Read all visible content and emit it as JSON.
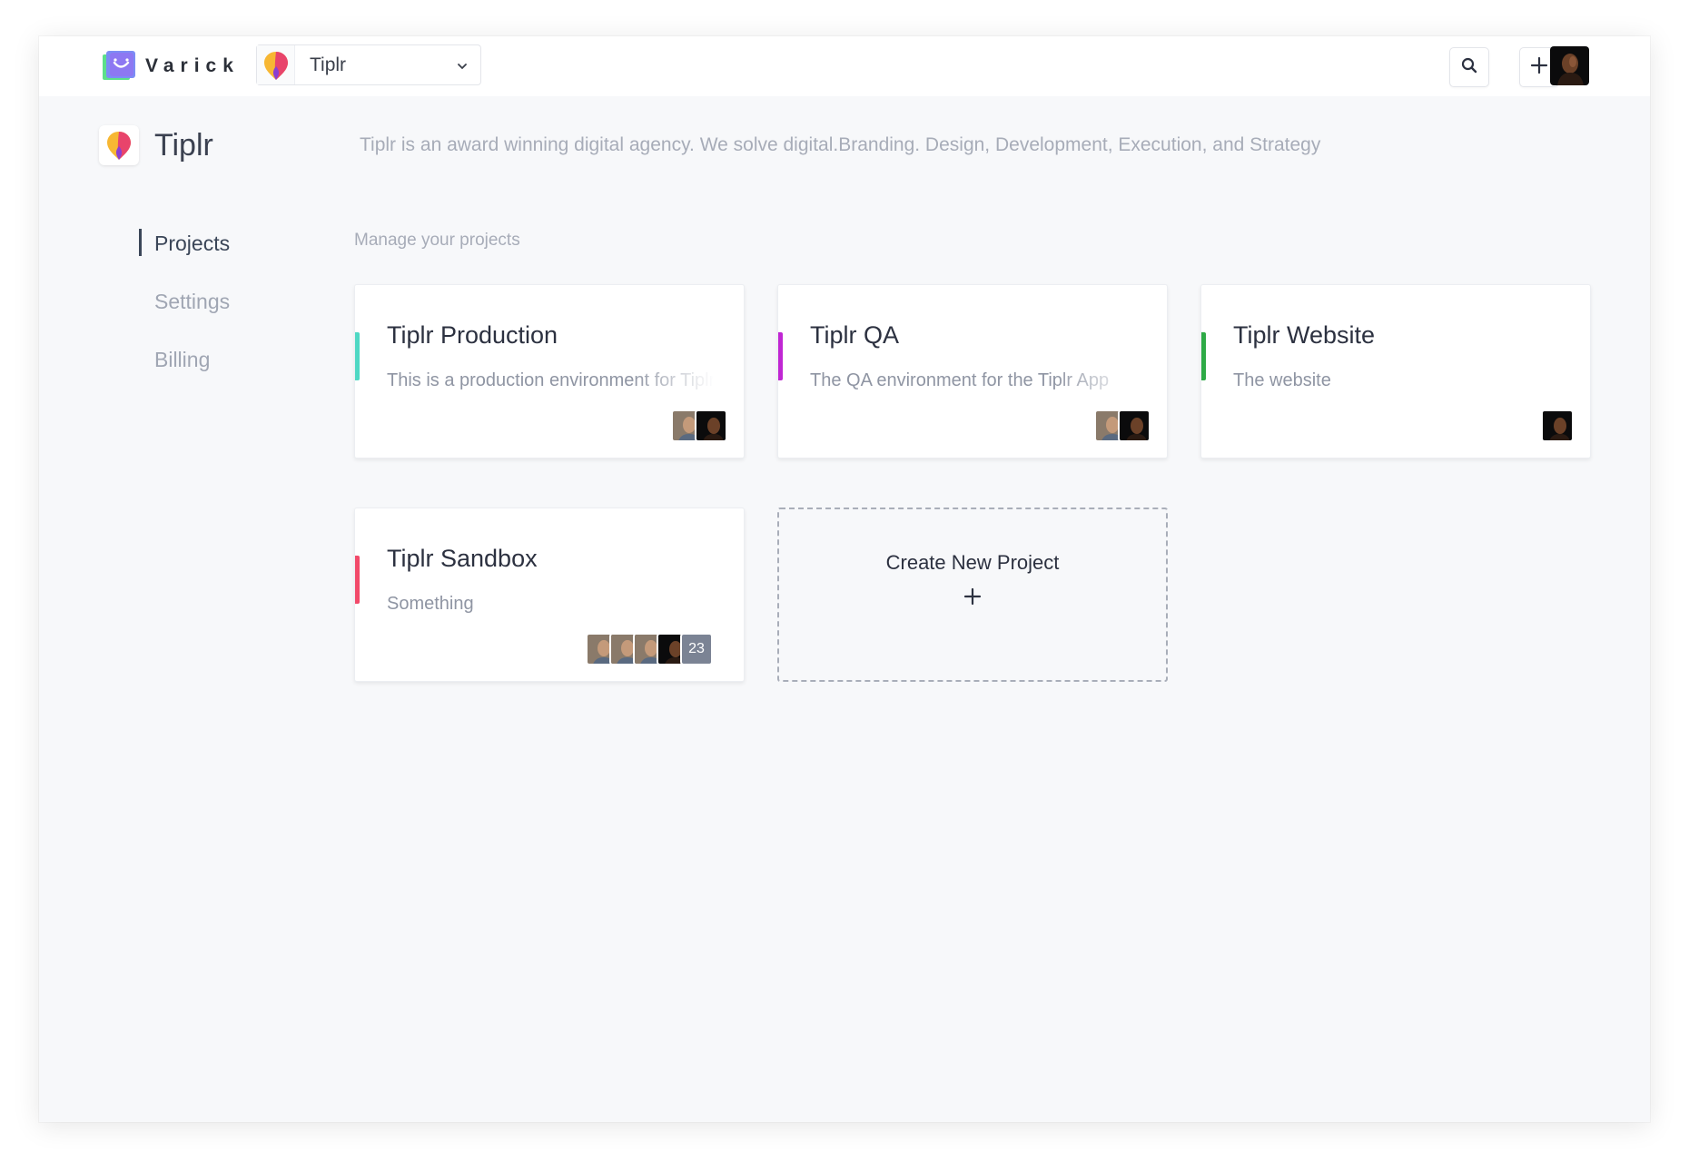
{
  "app": {
    "brand_name": "Varick"
  },
  "topbar": {
    "workspace_selected": "Tiplr",
    "search_icon": "search-icon",
    "add_icon": "plus-icon"
  },
  "organization": {
    "name": "Tiplr",
    "description": "Tiplr is an award winning digital agency. We solve digital.Branding. Design, Development, Execution, and Strategy"
  },
  "sidebar": {
    "items": [
      {
        "label": "Projects",
        "active": true
      },
      {
        "label": "Settings",
        "active": false
      },
      {
        "label": "Billing",
        "active": false
      }
    ]
  },
  "main": {
    "section_label": "Manage your projects",
    "projects": [
      {
        "title": "Tiplr Production",
        "description": "This is a production environment for Tiplr",
        "accent": "#4fd8c4"
      },
      {
        "title": "Tiplr QA",
        "description": "The QA environment for the Tiplr App",
        "accent": "#c026d3"
      },
      {
        "title": "Tiplr Website",
        "description": "The website",
        "accent": "#2eaa46"
      },
      {
        "title": "Tiplr Sandbox",
        "description": "Something",
        "accent": "#f24a6a",
        "extra_members": "23"
      }
    ],
    "create_label": "Create New Project"
  },
  "colors": {
    "window_bg": "#f7f8fa",
    "text_dark": "#2c3140",
    "text_muted": "#a7acb8"
  }
}
